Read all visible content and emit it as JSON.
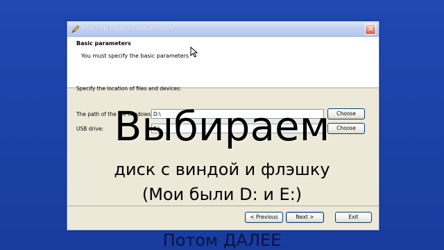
{
  "window": {
    "title": "Мастер подготовки Flash",
    "close_glyph": "✕"
  },
  "header": {
    "title": "Basic parameters",
    "subtitle": "You must specify the basic parameters"
  },
  "form": {
    "intro": "Specify the location of files and devices:",
    "windows_path_label": "The path of the file Windows:",
    "windows_path_value": "D:\\",
    "usb_label": "USB drive:",
    "usb_value": "E:\\",
    "choose_label": "Choose"
  },
  "buttons": {
    "previous": "< Previous",
    "next": "Next >",
    "exit": "Exit"
  },
  "overlay": {
    "big": "Выбираем",
    "line1": "диск с виндой и флэшку",
    "line2": "(Мои были D: и E:)",
    "bottom": "Потом ДАЛЕЕ"
  },
  "colors": {
    "desktop": "#1a3fa3",
    "window_bg": "#ece9d8",
    "titlebar": "#c3d1f1",
    "close": "#d85a3f"
  },
  "icons": {
    "title": "pen-icon",
    "close": "close-icon",
    "cursor": "mouse-pointer-icon"
  }
}
